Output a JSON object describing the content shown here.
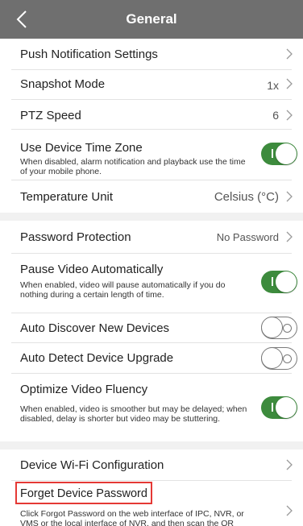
{
  "header": {
    "title": "General"
  },
  "rows": {
    "push": {
      "label": "Push Notification Settings"
    },
    "snapshot": {
      "label": "Snapshot Mode",
      "value": "1x"
    },
    "ptz": {
      "label": "PTZ Speed",
      "value": "6"
    },
    "timezone": {
      "label": "Use Device Time Zone",
      "desc": "When disabled, alarm notification and playback use the time of your mobile phone.",
      "enabled": true
    },
    "temperature": {
      "label": "Temperature Unit",
      "value": "Celsius (°C)"
    },
    "password": {
      "label": "Password Protection",
      "value": "No Password"
    },
    "pause": {
      "label": "Pause Video Automatically",
      "desc": "When enabled, video will pause automatically if you do nothing during a certain length of time.",
      "enabled": true
    },
    "discover": {
      "label": "Auto Discover New Devices",
      "enabled": false
    },
    "upgrade": {
      "label": "Auto Detect Device Upgrade",
      "enabled": false
    },
    "fluency": {
      "label": "Optimize Video Fluency",
      "desc": "When enabled, video is smoother but may be delayed; when disabled, delay is shorter but video may be stuttering.",
      "enabled": true
    },
    "wifi": {
      "label": "Device Wi-Fi Configuration"
    },
    "forget": {
      "label": "Forget Device Password",
      "desc": "Click Forgot Password on the web interface of IPC, NVR, or VMS or the local interface of NVR, and then scan the QR"
    }
  },
  "colors": {
    "header": "#6f6f6f",
    "toggle_on": "#3d8b3d",
    "highlight": "#e53935"
  },
  "icons": {
    "back": "chevron-left-icon",
    "row_arrow": "chevron-right-icon"
  }
}
